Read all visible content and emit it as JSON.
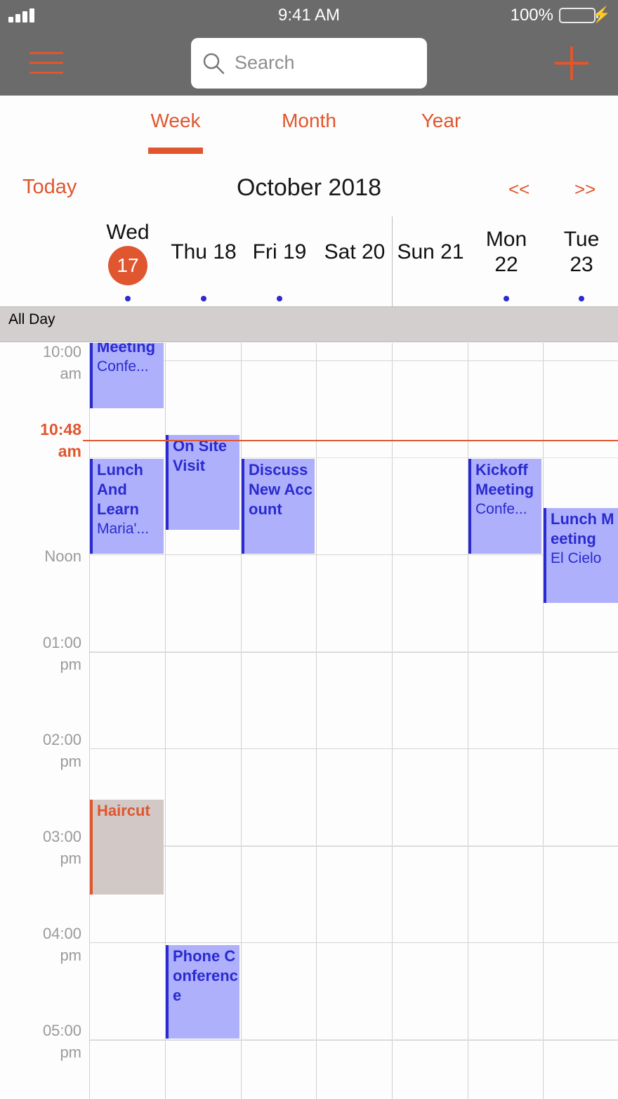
{
  "status_bar": {
    "time": "9:41 AM",
    "battery": "100%"
  },
  "toolbar": {
    "search_placeholder": "Search"
  },
  "tabs": [
    {
      "label": "Week",
      "selected": true
    },
    {
      "label": "Month",
      "selected": false
    },
    {
      "label": "Year",
      "selected": false
    }
  ],
  "nav": {
    "today": "Today",
    "title": "October 2018",
    "prev": "<<",
    "next": ">>"
  },
  "days": [
    {
      "name": "Wed",
      "num": "17",
      "today": true,
      "has_events": true
    },
    {
      "label": "Thu 18",
      "has_events": true
    },
    {
      "label": "Fri 19",
      "has_events": true
    },
    {
      "label": "Sat 20",
      "has_events": false
    },
    {
      "label": "Sun 21",
      "has_events": false
    },
    {
      "name": "Mon",
      "num": "22",
      "has_events": true
    },
    {
      "name": "Tue",
      "num": "23",
      "has_events": true
    }
  ],
  "all_day_label": "All Day",
  "time_labels": [
    {
      "line1": "10:00",
      "line2": "am"
    },
    {
      "line1": "Noon",
      "line2": ""
    },
    {
      "line1": "01:00",
      "line2": "pm"
    },
    {
      "line1": "02:00",
      "line2": "pm"
    },
    {
      "line1": "03:00",
      "line2": "pm"
    },
    {
      "line1": "04:00",
      "line2": "pm"
    },
    {
      "line1": "05:00",
      "line2": "pm"
    }
  ],
  "now": {
    "line1": "10:48",
    "line2": "am"
  },
  "events": [
    {
      "title": "Meeting",
      "location": "Confe...",
      "day": 0,
      "kind": "work"
    },
    {
      "title": "Lunch And Learn",
      "location": "Maria'...",
      "day": 0,
      "kind": "work"
    },
    {
      "title": "On Site Visit",
      "location": "",
      "day": 1,
      "kind": "work"
    },
    {
      "title": "Discuss New Account",
      "location": "",
      "day": 2,
      "kind": "work"
    },
    {
      "title": "Kickoff Meeting",
      "location": "Confe...",
      "day": 5,
      "kind": "work"
    },
    {
      "title": "Lunch Meeting",
      "location": "El Cielo",
      "day": 6,
      "kind": "work"
    },
    {
      "title": "Haircut",
      "location": "",
      "day": 0,
      "kind": "personal"
    },
    {
      "title": "Phone Conference",
      "location": "",
      "day": 1,
      "kind": "work"
    }
  ],
  "colors": {
    "accent": "#e0562e",
    "event_fill": "#aeb0fb",
    "event_text": "#2a2ad0",
    "personal_fill": "#d2c9c7"
  }
}
